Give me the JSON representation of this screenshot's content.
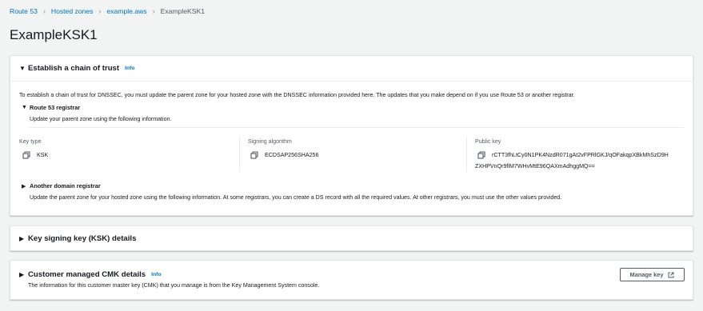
{
  "breadcrumb": {
    "items": [
      "Route 53",
      "Hosted zones",
      "example.aws"
    ],
    "current": "ExampleKSK1"
  },
  "page_title": "ExampleKSK1",
  "chain_of_trust": {
    "title": "Establish a chain of trust",
    "info": "Info",
    "description": "To establish a chain of trust for DNSSEC, you must update the parent zone for your hosted zone with the DNSSEC information provided here. The updates that you make depend on if you use Route 53 or another registrar.",
    "route53_registrar": {
      "title": "Route 53 registrar",
      "subtitle": "Update your parent zone using the following information.",
      "key_type_label": "Key type",
      "key_type_value": "KSK",
      "signing_algorithm_label": "Signing algorithm",
      "signing_algorithm_value": "ECDSAP256SHA256",
      "public_key_label": "Public key",
      "public_key_line1": "rCTT3fhLtCy0N1PK4NzdR071gAt2vFPRlGKJ/qOFakqpXBkMhSzD9H",
      "public_key_line2": "ZXHPVnQr9flM7WHvMtE96QAXmAdhggMQ=="
    },
    "other_registrar": {
      "title": "Another domain registrar",
      "subtitle": "Update the parent zone for your hosted zone using the following information. At some registrars, you can create a DS record with all the required values. At other registrars, you must use the other values provided."
    }
  },
  "ksk_details": {
    "title": "Key signing key (KSK) details"
  },
  "cmk_details": {
    "title": "Customer managed CMK details",
    "info": "Info",
    "description": "The information for this customer master key (CMK) that you manage is from the Key Management System console.",
    "manage_key_label": "Manage key"
  },
  "colors": {
    "link": "#0073bb",
    "background": "#f2f3f3",
    "panel": "#ffffff",
    "text": "#16191f",
    "muted": "#545b64"
  },
  "icons": [
    "chevron-right-icon",
    "caret-down-icon",
    "caret-right-icon",
    "copy-icon",
    "external-link-icon"
  ]
}
